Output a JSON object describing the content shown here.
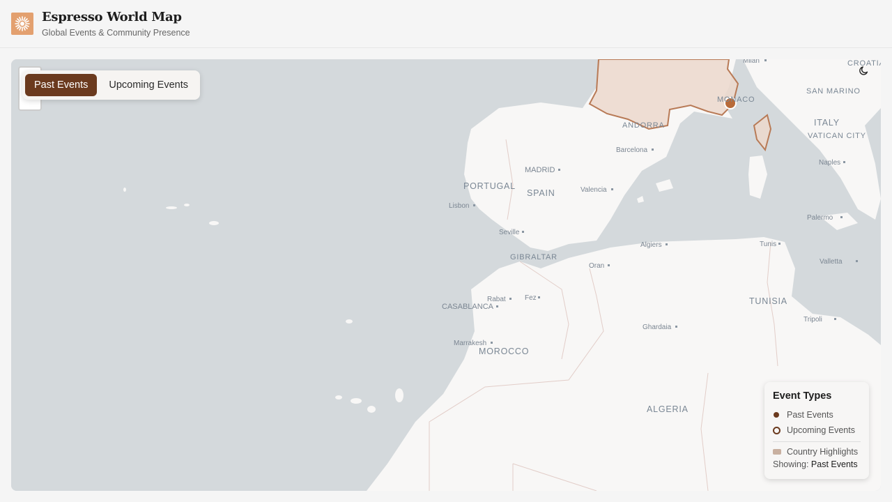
{
  "header": {
    "title": "Espresso World Map",
    "subtitle": "Global Events & Community Presence"
  },
  "toggle": {
    "past_label": "Past Events",
    "upcoming_label": "Upcoming Events",
    "active": "past"
  },
  "map": {
    "countries": [
      "PORTUGAL",
      "SPAIN",
      "GIBRALTAR",
      "MOROCCO",
      "ALGERIA",
      "TUNISIA",
      "ITALY",
      "SAN MARINO",
      "VATICAN CITY",
      "CROATIA",
      "MONACO",
      "ANDORRA"
    ],
    "cities": [
      "Milan",
      "Barcelona",
      "MADRID",
      "Valencia",
      "Lisbon",
      "Seville",
      "Oran",
      "Algiers",
      "Tunis",
      "Rabat",
      "Fez",
      "CASABLANCA",
      "Marrakesh",
      "Ghardaia",
      "Naples",
      "Palermo",
      "Valletta",
      "Tripoli"
    ],
    "highlighted_regions": [
      "France",
      "Corsica"
    ],
    "event_markers": [
      {
        "type": "past",
        "place": "Monaco"
      }
    ]
  },
  "legend": {
    "title": "Event Types",
    "past": "Past Events",
    "upcoming": "Upcoming Events",
    "highlights": "Country Highlights",
    "showing_label": "Showing:",
    "showing_value": "Past Events"
  },
  "colors": {
    "accent": "#6b3a1e",
    "marker": "#b86b3a",
    "highlight_fill": "#ecd8cc",
    "highlight_stroke": "#b87a56",
    "water": "#d4d9dc",
    "land": "#f8f7f6"
  },
  "icons": {
    "logo": "sunburst-logo-icon",
    "theme": "moon-icon"
  }
}
